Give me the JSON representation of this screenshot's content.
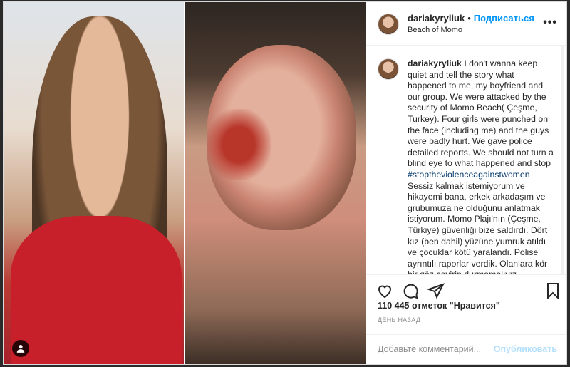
{
  "post": {
    "username": "dariakyryliuk",
    "follow_label": "Подписаться",
    "location": "Beach of Momo",
    "more_icon": "more-horizontal-icon"
  },
  "caption": {
    "username": "dariakyryliuk",
    "text_before_hashtag": "I don't wanna keep quiet and tell the story what happened to me, my boyfriend and our group. We were attacked by the security of Momo Beach( Çeşme, Turkey). Four girls were punched on the face (including me) and the guys were badly hurt. We gave police detailed reports. We should not turn a blind eye to what happened and stop",
    "hashtag": "#stoptheviolenceagainstwomen",
    "text_after_hashtag": "Sessiz kalmak istemiyorum ve hikayemi bana, erkek arkadaşım ve grubumuza ne olduğunu anlatmak istiyorum. Momo Plajı'nın (Çeşme, Türkiye) güvenliği bize saldırdı. Dört kız (ben dahil) yüzüne yumruk atıldı ve çocuklar kötü yaralandı. Polise ayrıntılı raporlar verdik. Olanlara kör bir göz çevirip durmamalıyız"
  },
  "engagement": {
    "likes": "110 445 отметок \"Нравится\"",
    "time_ago": "ДЕНЬ НАЗАД"
  },
  "comment_input": {
    "placeholder": "Добавьте комментарий...",
    "post_label": "Опубликовать"
  },
  "icons": [
    "heart-icon",
    "comment-icon",
    "share-icon",
    "bookmark-icon",
    "user-tag-icon"
  ],
  "colors": {
    "link_blue": "#0095f6",
    "hashtag_blue": "#00376b",
    "text": "#262626",
    "muted": "#8e8e8e"
  }
}
